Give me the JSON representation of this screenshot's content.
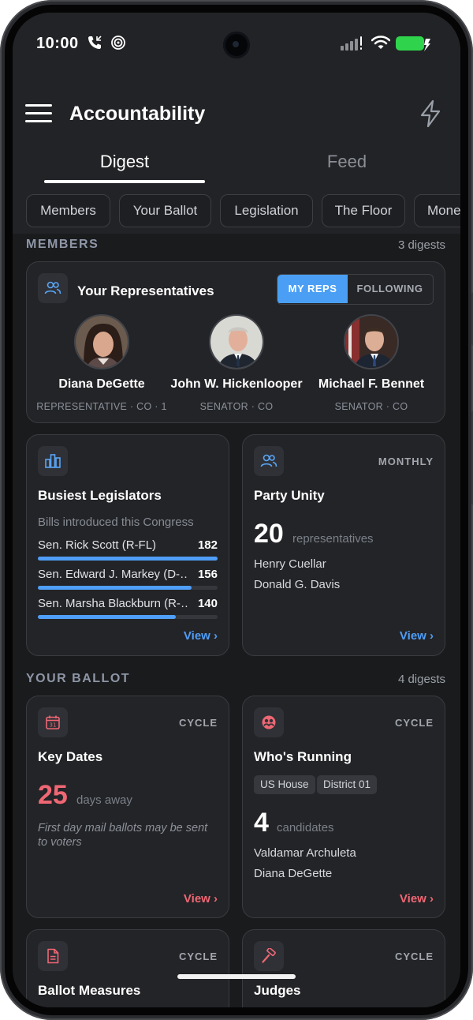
{
  "status_bar": {
    "time": "10:00"
  },
  "app": {
    "title": "Accountability"
  },
  "tabs": [
    {
      "label": "Digest",
      "active": true
    },
    {
      "label": "Feed",
      "active": false
    }
  ],
  "chips": [
    "Members",
    "Your Ballot",
    "Legislation",
    "The Floor",
    "Money"
  ],
  "members_section": {
    "heading": "MEMBERS",
    "count": "3 digests"
  },
  "reps_card": {
    "title": "Your Representatives",
    "toggle": {
      "active": "MY REPS",
      "inactive": "FOLLOWING"
    },
    "reps": [
      {
        "name": "Diana DeGette",
        "role": "REPRESENTATIVE · CO · 1"
      },
      {
        "name": "John W. Hickenlooper",
        "role": "SENATOR · CO"
      },
      {
        "name": "Michael F. Bennet",
        "role": "SENATOR · CO"
      }
    ]
  },
  "busiest_card": {
    "title": "Busiest Legislators",
    "subtitle": "Bills introduced this Congress",
    "rows": [
      {
        "name": "Sen. Rick Scott (R-FL)",
        "value": "182",
        "fraction": 1.0
      },
      {
        "name": "Sen. Edward J. Markey (D-…",
        "value": "156",
        "fraction": 0.857
      },
      {
        "name": "Sen. Marsha Blackburn (R-…",
        "value": "140",
        "fraction": 0.769
      }
    ],
    "view": "View ›"
  },
  "unity_card": {
    "title": "Party Unity",
    "tag": "MONTHLY",
    "number": "20",
    "unit": "representatives",
    "names": [
      "Henry Cuellar",
      "Donald G. Davis"
    ],
    "view": "View ›"
  },
  "ballot_section": {
    "heading": "YOUR BALLOT",
    "count": "4 digests"
  },
  "dates_card": {
    "title": "Key Dates",
    "tag": "CYCLE",
    "number": "25",
    "unit": "days away",
    "note": "First day mail ballots may be sent to voters",
    "view": "View ›"
  },
  "running_card": {
    "title": "Who's Running",
    "tag": "CYCLE",
    "pills": [
      "US House",
      "District 01"
    ],
    "number": "4",
    "unit": "candidates",
    "names": [
      "Valdamar Archuleta",
      "Diana DeGette"
    ],
    "view": "View ›"
  },
  "measures_card": {
    "title": "Ballot Measures",
    "tag": "CYCLE"
  },
  "judges_card": {
    "title": "Judges",
    "tag": "CYCLE"
  },
  "colors": {
    "accent_blue": "#4f9ef8",
    "accent_red": "#f06774",
    "background": "#1a1b1d",
    "card": "#232427"
  },
  "icons": [
    "menu-icon",
    "bolt-icon",
    "people-icon",
    "bar-chart-icon",
    "calendar-icon",
    "group-icon",
    "document-icon",
    "gavel-icon"
  ]
}
